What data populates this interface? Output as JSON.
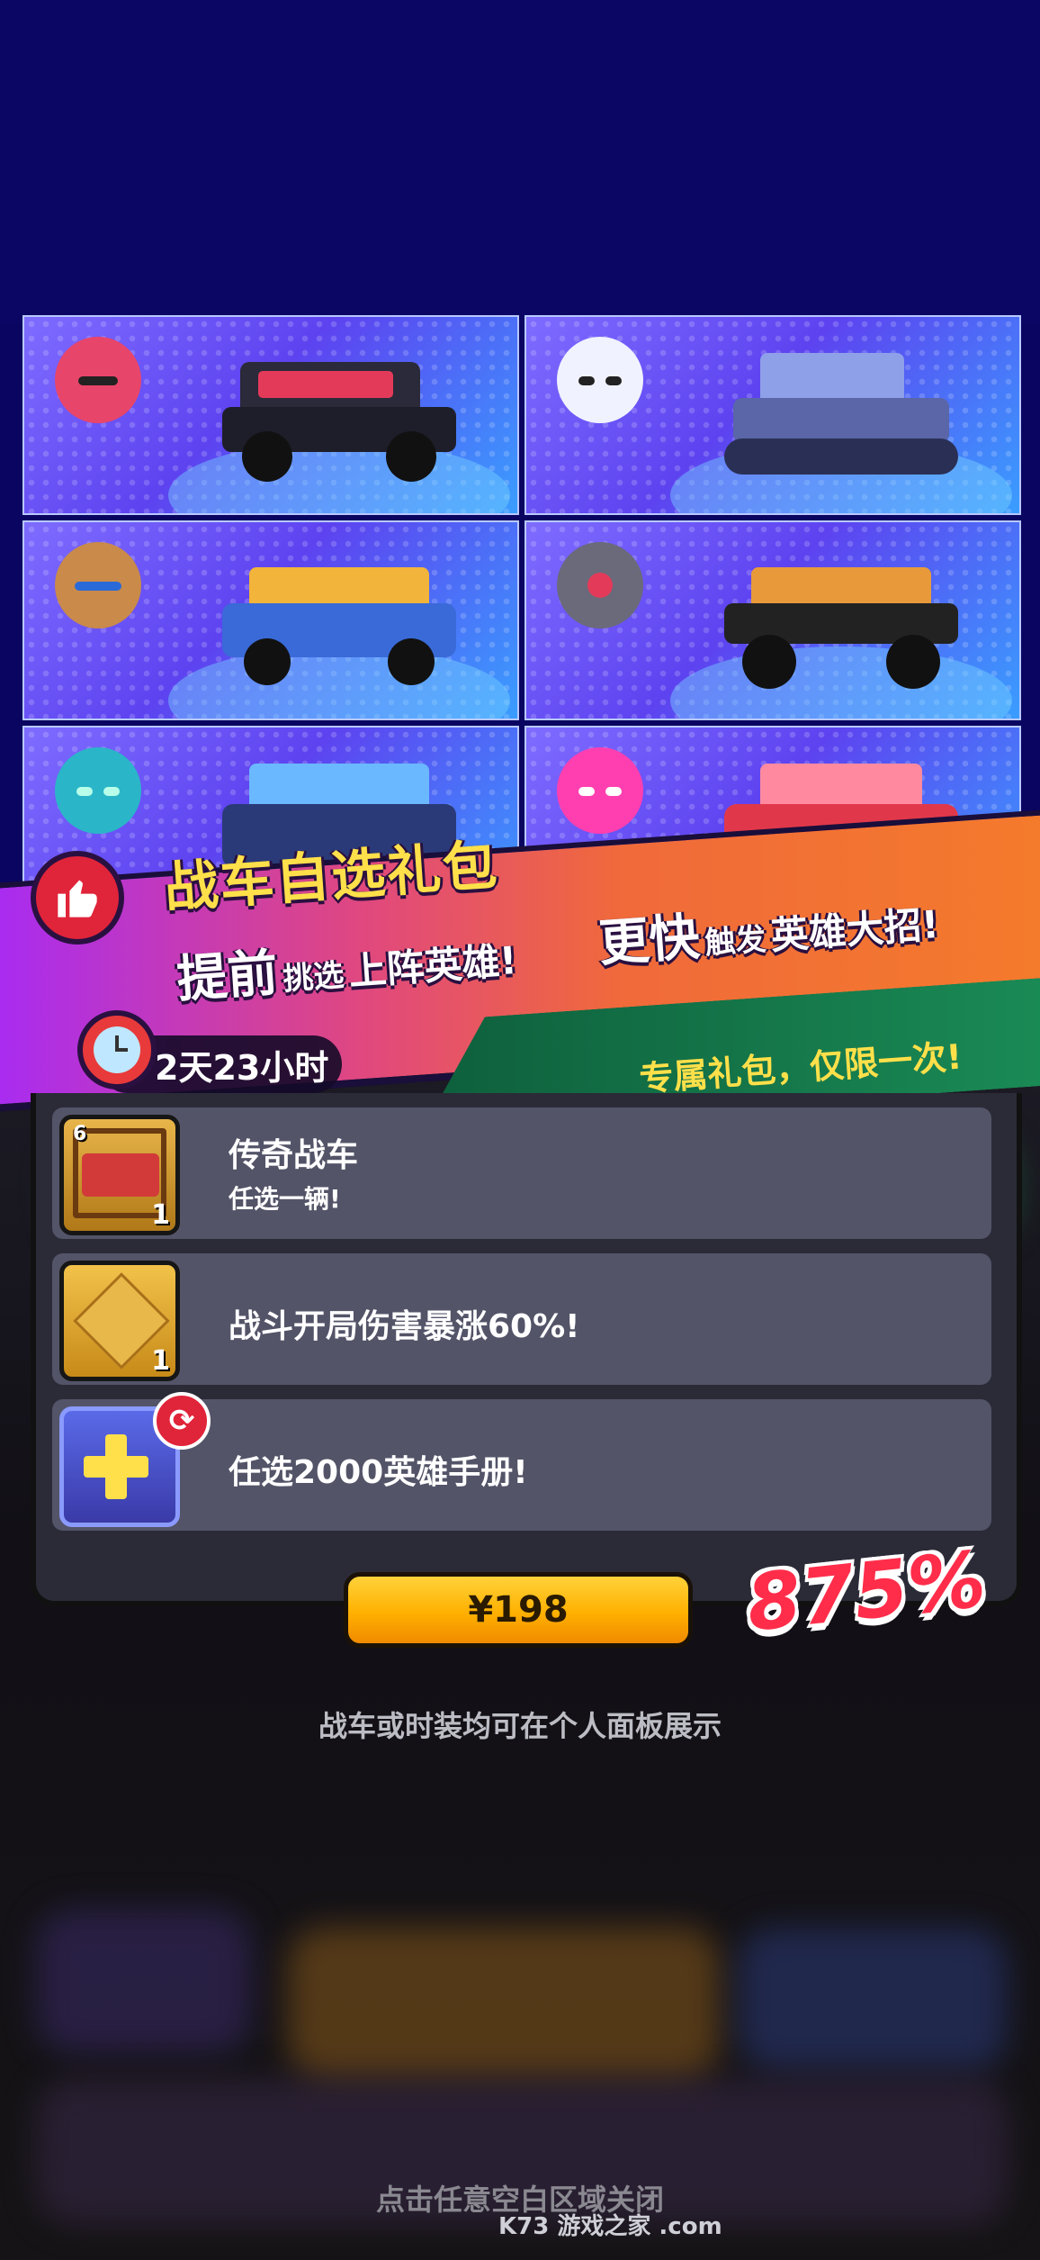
{
  "cards": [
    {
      "hero": "hero-red-headset",
      "hero_color": "#e8456a",
      "car": "black-red-truck",
      "car_color": "#2a2a3a",
      "accent": "#e43a5a"
    },
    {
      "hero": "hero-skull-mask",
      "hero_color": "#f0f2ff",
      "car": "tracked-jeep",
      "car_color": "#5a66a8",
      "accent": "#8ea0e8"
    },
    {
      "hero": "hero-monkey",
      "hero_color": "#c98a4a",
      "car": "blue-flame-jeep",
      "car_color": "#3a6ad8",
      "accent": "#f2b43a"
    },
    {
      "hero": "hero-robot-eye",
      "hero_color": "#6a6a7a",
      "car": "orange-offroad-buggy",
      "car_color": "#e89a3a",
      "accent": "#222"
    },
    {
      "hero": "hero-teal-alien",
      "hero_color": "#2ab6c8",
      "car": "blue-armored-truck",
      "car_color": "#2a3a78",
      "accent": "#6ab8ff"
    },
    {
      "hero": "hero-pink-hair",
      "hero_color": "#ff3fb0",
      "car": "red-classic-car",
      "car_color": "#e0384a",
      "accent": "#ff8aa0"
    }
  ],
  "banner": {
    "title": "战车自选礼包",
    "line1_a": "提前",
    "line1_b": "挑选",
    "line1_c": "上阵英雄!",
    "line2_a": "更快",
    "line2_b": "触发",
    "line2_c": "英雄大招!",
    "timer": "2天23小时",
    "exclusive": "专属礼包，仅限一次!"
  },
  "items": [
    {
      "title": "传奇战车",
      "subtitle": "任选一辆!",
      "qty": "1",
      "badge": "6",
      "icon": "crate-car-icon"
    },
    {
      "title": "战斗开局伤害暴涨60%!",
      "qty": "1",
      "icon": "gold-cube-icon"
    },
    {
      "title": "任选2000英雄手册!",
      "icon": "plus-swap-icon"
    }
  ],
  "watermark": "K73 游戏之家 .com",
  "price": "¥198",
  "percent": "875%",
  "info_note": "战车或时装均可在个人面板展示",
  "close_note": "点击任意空白区域关闭",
  "colors": {
    "primary_button": "#ffb000",
    "percent": "#ff2d4a",
    "title": "#ffe04a"
  }
}
